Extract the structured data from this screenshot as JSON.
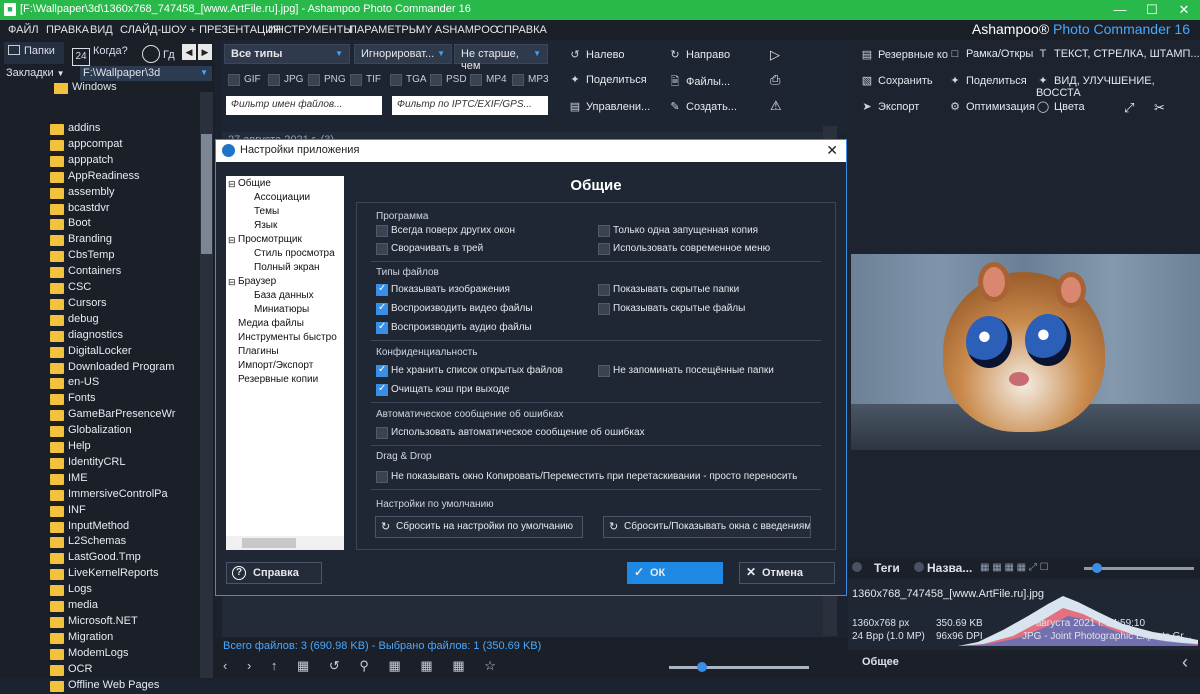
{
  "window": {
    "title": "[F:\\Wallpaper\\3d\\1360x768_747458_[www.ArtFile.ru].jpg] - Ashampoo Photo Commander 16",
    "brand": "Ashampoo® Photo Commander 16",
    "brand_prefix": "Ashampoo®",
    "brand_product": "Photo Commander 16",
    "minimize": "—",
    "maximize": "☐",
    "close": "✕"
  },
  "menu": [
    "ФАЙЛ",
    "ПРАВКА",
    "ВИД",
    "СЛАЙД-ШОУ + ПРЕЗЕНТАЦИЯ",
    "ИНСТРУМЕНТЫ",
    "ПАРАМЕТРЫ",
    "MY ASHAMPOO",
    "СПРАВКА"
  ],
  "left": {
    "tab_folders": "Папки",
    "tab_when": "Когда?",
    "tab_where": "Гд",
    "calendar_num": "24",
    "bookmarks_label": "Закладки",
    "path": "F:\\Wallpaper\\3d",
    "root": "Windows",
    "folders": [
      "addins",
      "appcompat",
      "apppatch",
      "AppReadiness",
      "assembly",
      "bcastdvr",
      "Boot",
      "Branding",
      "CbsTemp",
      "Containers",
      "CSC",
      "Cursors",
      "debug",
      "diagnostics",
      "DigitalLocker",
      "Downloaded Program",
      "en-US",
      "Fonts",
      "GameBarPresenceWr",
      "Globalization",
      "Help",
      "IdentityCRL",
      "IME",
      "ImmersiveControlPa",
      "INF",
      "InputMethod",
      "L2Schemas",
      "LastGood.Tmp",
      "LiveKernelReports",
      "Logs",
      "media",
      "Microsoft.NET",
      "Migration",
      "ModemLogs",
      "OCR",
      "Offline Web Pages"
    ]
  },
  "filters": {
    "type": "Все типы",
    "ignore": "Игнорироват...",
    "age": "Не старше, чем",
    "types": [
      "GIF",
      "JPG",
      "PNG",
      "TIF",
      "TGA",
      "PSD",
      "MP4",
      "MP3"
    ],
    "name_filter_placeholder": "Фильтр имен файлов...",
    "iptc_filter_placeholder": "Фильтр по IPTC/EXIF/GPS..."
  },
  "toolbar_mid": {
    "rotate_left": "Налево",
    "rotate_right": "Направо",
    "share": "Поделиться",
    "files": "Файлы...",
    "manage": "Управлени...",
    "create": "Создать..."
  },
  "toolbar_right": {
    "backup": "Резервные ко",
    "frame": "Рамка/Откры",
    "text": "ТЕКСТ, СТРЕЛКА, ШТАМП...",
    "save": "Сохранить",
    "share": "Поделиться",
    "view": "ВИД, УЛУЧШЕНИЕ, ВОССТА",
    "export": "Экспорт",
    "optimize": "Оптимизация",
    "colors": "Цвета"
  },
  "list_header": "27 августа 2021 г. (3)",
  "dialog": {
    "title": "Настройки приложения",
    "heading": "Общие",
    "nav": [
      {
        "label": "Общие",
        "level": 0
      },
      {
        "label": "Ассоциации",
        "level": 1
      },
      {
        "label": "Темы",
        "level": 1
      },
      {
        "label": "Язык",
        "level": 1
      },
      {
        "label": "Просмотрщик",
        "level": 0
      },
      {
        "label": "Стиль просмотра",
        "level": 1
      },
      {
        "label": "Полный экран",
        "level": 1
      },
      {
        "label": "Браузер",
        "level": 0
      },
      {
        "label": "База данных",
        "level": 1
      },
      {
        "label": "Миниатюры",
        "level": 1
      },
      {
        "label": "Медиа файлы",
        "level": 0
      },
      {
        "label": "Инструменты быстро",
        "level": 0
      },
      {
        "label": "Плагины",
        "level": 0
      },
      {
        "label": "Импорт/Экспорт",
        "level": 0
      },
      {
        "label": "Резервные копии",
        "level": 0
      }
    ],
    "sections": {
      "program": "Программа",
      "filetypes": "Типы файлов",
      "privacy": "Конфиденциальность",
      "errors": "Автоматическое сообщение об ошибках",
      "dragdrop": "Drag & Drop",
      "defaults": "Настройки по умолчанию"
    },
    "options": {
      "always_on_top": "Всегда поверх других окон",
      "single_instance": "Только одна запущенная копия",
      "minimize_tray": "Сворачивать в трей",
      "modern_menu": "Использовать современное меню",
      "show_images": "Показывать изображения",
      "show_hidden_folders": "Показывать скрытые папки",
      "play_video": "Воспроизводить видео файлы",
      "show_hidden_files": "Показывать скрытые файлы",
      "play_audio": "Воспроизводить аудио файлы",
      "no_recent_list": "Не хранить список открытых файлов",
      "no_remember_folders": "Не запоминать посещённые папки",
      "clear_cache": "Очищать кэш при выходе",
      "auto_error_report": "Использовать автоматическое сообщение об ошибках",
      "no_copy_dialog": "Не показывать окно Копировать/Переместить при перетаскивании - просто переносить"
    },
    "reset_defaults": "Сбросить на настройки по умолчанию",
    "reset_intro": "Сбросить/Показывать окна с введениями",
    "help": "Справка",
    "ok": "ОК",
    "cancel": "Отмена"
  },
  "status": {
    "summary": "Всего файлов: 3 (690.98 KB) - Выбрано файлов: 1 (350.69 KB)"
  },
  "info": {
    "tab_tags": "Теги",
    "tab_name": "Назва...",
    "filename": "1360x768_747458_[www.ArtFile.ru].jpg",
    "dims": "1360x768 px",
    "size": "350.69 KB",
    "bpp": "24 Bpp (1.0 MP)",
    "dpi": "96x96 DPI",
    "date": "27 августа 2021 г. 14:59:10",
    "format": "JPG - Joint Photographic Experts Gr...",
    "bottom_label": "Общее"
  }
}
